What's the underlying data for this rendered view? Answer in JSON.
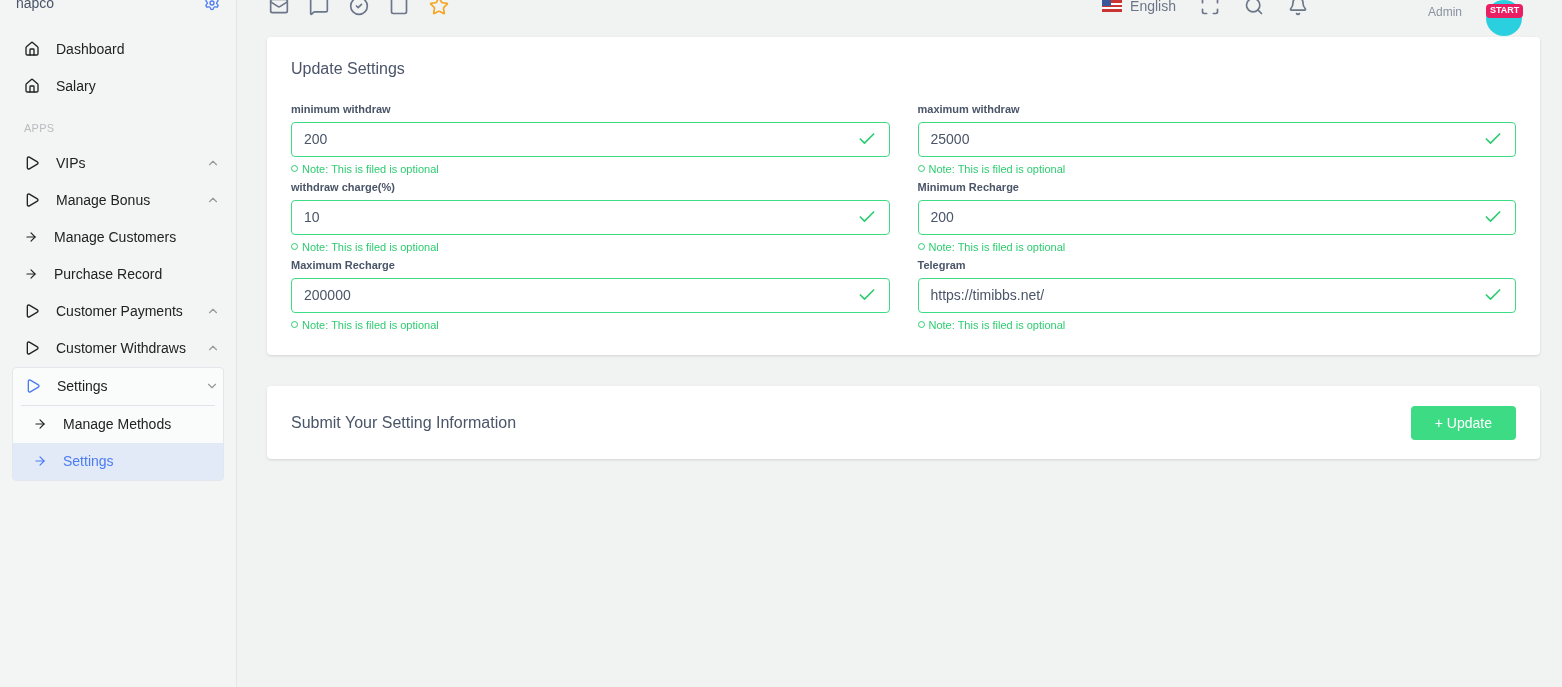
{
  "brand": "napco",
  "sidebar": {
    "items": [
      {
        "label": "Dashboard",
        "kind": "home"
      },
      {
        "label": "Salary",
        "kind": "home"
      },
      {
        "label": "APPS",
        "kind": "section"
      },
      {
        "label": "VIPs",
        "kind": "play",
        "expanded": false
      },
      {
        "label": "Manage Bonus",
        "kind": "play",
        "expanded": false
      },
      {
        "label": "Manage Customers",
        "kind": "arrow"
      },
      {
        "label": "Purchase Record",
        "kind": "arrow"
      },
      {
        "label": "Customer Payments",
        "kind": "play",
        "expanded": false
      },
      {
        "label": "Customer Withdraws",
        "kind": "play",
        "expanded": false
      },
      {
        "label": "Settings",
        "kind": "play",
        "expanded": true,
        "selected": true,
        "children": [
          {
            "label": "Manage Methods",
            "kind": "arrow",
            "selected": false
          },
          {
            "label": "Settings",
            "kind": "arrow",
            "selected": true
          }
        ]
      }
    ]
  },
  "header": {
    "language": "English",
    "role": "Admin",
    "avatar_badge": "START"
  },
  "settings_card": {
    "title": "Update Settings",
    "fields": [
      {
        "label": "minimum withdraw",
        "value": "200",
        "valid": true,
        "note": "Note: This is filed is optional"
      },
      {
        "label": "maximum withdraw",
        "value": "25000",
        "valid": true,
        "note": "Note: This is filed is optional"
      },
      {
        "label": "withdraw charge(%)",
        "value": "10",
        "valid": true,
        "note": "Note: This is filed is optional"
      },
      {
        "label": "Minimum Recharge",
        "value": "200",
        "valid": true,
        "note": "Note: This is filed is optional"
      },
      {
        "label": "Maximum Recharge",
        "value": "200000",
        "valid": true,
        "note": "Note: This is filed is optional"
      },
      {
        "label": "Telegram",
        "value": "https://timibbs.net/",
        "valid": true,
        "note": "Note: This is filed is optional"
      }
    ]
  },
  "submit_card": {
    "title": "Submit Your Setting Information",
    "button": "+ Update"
  }
}
